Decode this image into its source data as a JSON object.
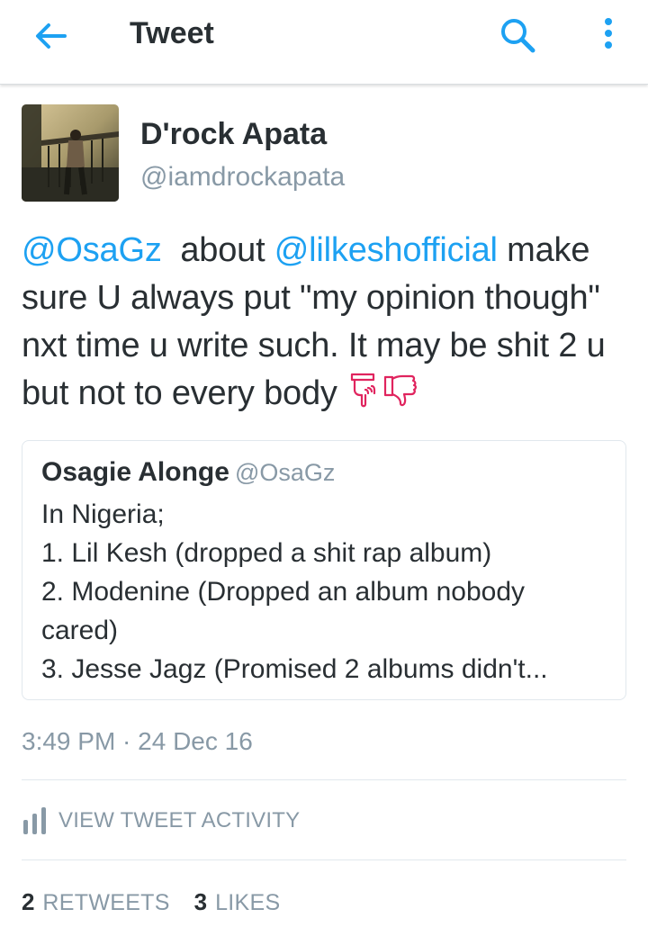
{
  "header": {
    "title": "Tweet",
    "back_icon": "arrow-left-icon",
    "search_icon": "search-icon",
    "more_icon": "more-vertical-icon",
    "accent_color": "#1da1f2"
  },
  "tweet": {
    "author": {
      "name": "D'rock Apata",
      "handle": "@iamdrockapata"
    },
    "segments": [
      {
        "text": "@OsaGz",
        "type": "mention"
      },
      {
        "text": "  about ",
        "type": "text"
      },
      {
        "text": "@lilkeshofficial",
        "type": "mention"
      },
      {
        "text": " make sure U always put \"my opinion though\" nxt time u write such. It may be shit 2 u but not to every body",
        "type": "text"
      }
    ],
    "emojis": [
      "backhand-index-pointing-down-icon",
      "thumbs-down-icon"
    ],
    "quoted": {
      "name": "Osagie Alonge",
      "handle": "@OsaGz",
      "lines": [
        "In Nigeria;",
        "1. Lil Kesh (dropped a shit rap album)",
        "2. Modenine (Dropped an album nobody",
        "cared)",
        "3. Jesse Jagz (Promised 2 albums didn't..."
      ]
    },
    "timestamp": "3:49 PM · 24 Dec 16"
  },
  "activity": {
    "label": "VIEW TWEET ACTIVITY",
    "icon": "bar-chart-icon"
  },
  "stats": {
    "retweets_count": "2",
    "retweets_label": "RETWEETS",
    "likes_count": "3",
    "likes_label": "LIKES"
  },
  "colors": {
    "mention": "#1da1f2",
    "secondary_text": "#8899a6",
    "emoji": "#e0245e"
  }
}
